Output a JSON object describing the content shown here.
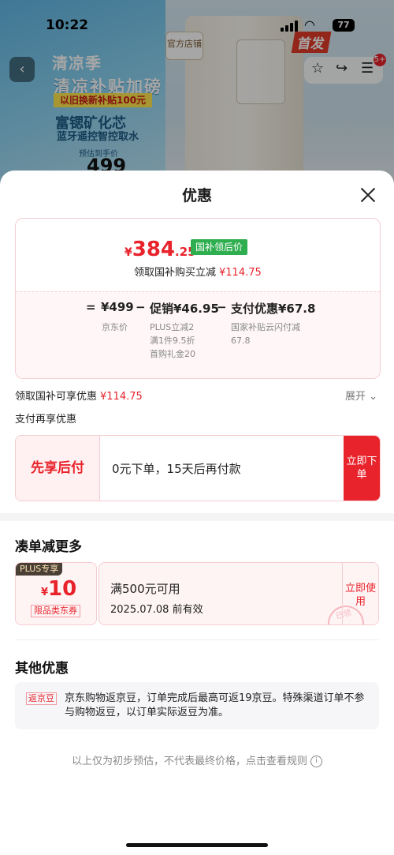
{
  "status": {
    "time": "10:22",
    "battery": "77"
  },
  "background": {
    "promo_line1": "清凉季",
    "promo_line2": "清凉补贴加磅",
    "promo_line3": "以旧换新补贴100元",
    "promo_line4": "富锶矿化芯",
    "promo_line5": "蓝牙遥控智控取水",
    "promo_line6": "预估到手价",
    "promo_price": "499",
    "store_badge": "官方店铺",
    "new_tag": "首发",
    "cart_badge": "5+"
  },
  "sheet": {
    "title": "优惠",
    "price": {
      "currency": "¥",
      "integer": "384",
      "decimal": ".25",
      "tag": "国补领后价"
    },
    "subsidy_line": {
      "label": "领取国补购买立减",
      "value": "¥114.75"
    },
    "formula": {
      "eq": "=",
      "jd_price": "¥499",
      "minus1": "−",
      "promo": "促销¥46.95",
      "minus2": "−",
      "pay": "支付优惠¥67.8",
      "jd_label": "京东价",
      "promo_notes": [
        "PLUS立减2",
        "满1件9.5折",
        "首购礼金20"
      ],
      "pay_note": "国家补贴云闪付减67.8"
    },
    "enjoy_line": {
      "label": "领取国补可享优惠",
      "value": "¥114.75"
    },
    "expand": "展开",
    "pay_again": "支付再享优惠",
    "paylater": {
      "label": "先享后付",
      "desc": "0元下单，15天后再付款",
      "button": "立即下单"
    },
    "more_section": "凑单减更多",
    "coupon": {
      "plus": "PLUS专享",
      "currency": "¥",
      "amount": "10",
      "type": "限品类东券",
      "condition": "满500元可用",
      "expiry": "2025.07.08 前有效",
      "button": "立即使用",
      "stamp": "已领"
    },
    "other_section": "其他优惠",
    "jd_bean": {
      "tag": "返京豆",
      "text": "京东购物返京豆，订单完成后最高可返19京豆。特殊渠道订单不参与购物返豆，以订单实际返豆为准。"
    },
    "footer": "以上仅为初步预估，不代表最终价格，点击查看规则"
  }
}
